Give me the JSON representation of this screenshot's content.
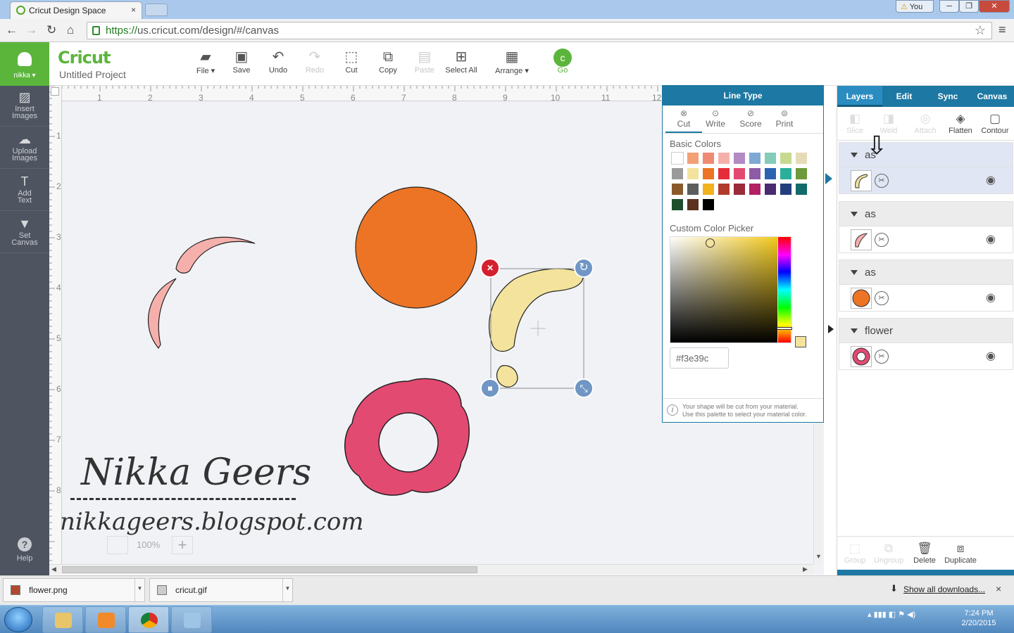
{
  "browser": {
    "tab_title": "Cricut Design Space",
    "tab_close": "×",
    "user_button": "You",
    "url_secure": "https://",
    "url_rest": "us.cricut.com/design/#/canvas"
  },
  "app": {
    "user_name": "nikka",
    "logo": "Cricut",
    "project_title": "Untitled Project",
    "toolbar": [
      {
        "label": "File",
        "icon": "folder-icon",
        "enabled": true
      },
      {
        "label": "Save",
        "icon": "save-icon",
        "enabled": true
      },
      {
        "label": "Undo",
        "icon": "undo-icon",
        "enabled": true
      },
      {
        "label": "Redo",
        "icon": "redo-icon",
        "enabled": false
      },
      {
        "label": "Cut",
        "icon": "cut-icon",
        "enabled": true
      },
      {
        "label": "Copy",
        "icon": "copy-icon",
        "enabled": true
      },
      {
        "label": "Paste",
        "icon": "paste-icon",
        "enabled": false
      },
      {
        "label": "Select All",
        "icon": "select-all-icon",
        "enabled": true
      },
      {
        "label": "Arrange",
        "icon": "arrange-icon",
        "enabled": true
      },
      {
        "label": "Go",
        "icon": "go-icon",
        "enabled": true
      }
    ]
  },
  "sidebar": {
    "items": [
      {
        "label1": "Insert",
        "label2": "Images"
      },
      {
        "label1": "Upload",
        "label2": "Images"
      },
      {
        "label1": "Add",
        "label2": "Text"
      },
      {
        "label1": "Set",
        "label2": "Canvas"
      }
    ],
    "help": "Help",
    "help_icon": "?"
  },
  "canvas": {
    "ruler_top": [
      "1",
      "2",
      "3",
      "4",
      "5",
      "6",
      "7",
      "8",
      "9",
      "10",
      "11",
      "12"
    ],
    "ruler_left": [
      "1",
      "2",
      "3",
      "4",
      "5",
      "6",
      "7",
      "8"
    ],
    "zoom": "100%",
    "colors": {
      "orange": "#ec7424",
      "pink": "#e34a72",
      "salmon": "#f6b0ab",
      "yellow": "#f3e39c"
    }
  },
  "line_type_panel": {
    "title": "Line Type",
    "tabs": [
      "Cut",
      "Write",
      "Score",
      "Print"
    ],
    "basic_colors_label": "Basic Colors",
    "basic_colors": [
      "#ffffff",
      "#f3a076",
      "#f08a72",
      "#f6b0ab",
      "#b28bc4",
      "#7fa8d3",
      "#84cbb9",
      "#c7d98e",
      "#e5dcb7",
      "#9a9a9a",
      "#f3e39c",
      "#ec7424",
      "#e52d3a",
      "#e34a72",
      "#8e5ba6",
      "#2b63b0",
      "#2aaf9b",
      "#6d9a3a",
      "#8b5a2b",
      "#5e5e5e",
      "#f2b21c",
      "#b23a2c",
      "#9b2a3a",
      "#b32064",
      "#4b2a70",
      "#233e7d",
      "#136a6a",
      "#1e4d2b",
      "#5a3320",
      "#000000"
    ],
    "custom_label": "Custom Color Picker",
    "hex_value": "#f3e39c",
    "note_line1": "Your shape will be cut from your material.",
    "note_line2": "Use this palette to select your material color."
  },
  "layers_panel": {
    "tabs": [
      "Layers",
      "Edit",
      "Sync",
      "Canvas"
    ],
    "tools": [
      {
        "label": "Slice",
        "enabled": false
      },
      {
        "label": "Weld",
        "enabled": false
      },
      {
        "label": "Attach",
        "enabled": false
      },
      {
        "label": "Flatten",
        "enabled": true
      },
      {
        "label": "Contour",
        "enabled": true
      }
    ],
    "groups": [
      {
        "name": "as",
        "thumb_color": "#f3e39c",
        "selected": true
      },
      {
        "name": "as",
        "thumb_color": "#f6b0ab",
        "selected": false
      },
      {
        "name": "as",
        "thumb_color": "#ec7424",
        "selected": false
      },
      {
        "name": "flower",
        "thumb_color": "#e34a72",
        "selected": false
      }
    ],
    "bottom_tools": [
      {
        "label": "Group",
        "enabled": false
      },
      {
        "label": "Ungroup",
        "enabled": false
      },
      {
        "label": "Delete",
        "enabled": true
      },
      {
        "label": "Duplicate",
        "enabled": true
      }
    ]
  },
  "downloads": {
    "items": [
      "flower.png",
      "cricut.gif"
    ],
    "show_all": "Show all downloads...",
    "close": "×"
  },
  "taskbar": {
    "time": "7:24 PM",
    "date": "2/20/2015"
  },
  "watermark": {
    "name": "Nikka Geers",
    "blog": "nikkageers.blogspot.com"
  }
}
